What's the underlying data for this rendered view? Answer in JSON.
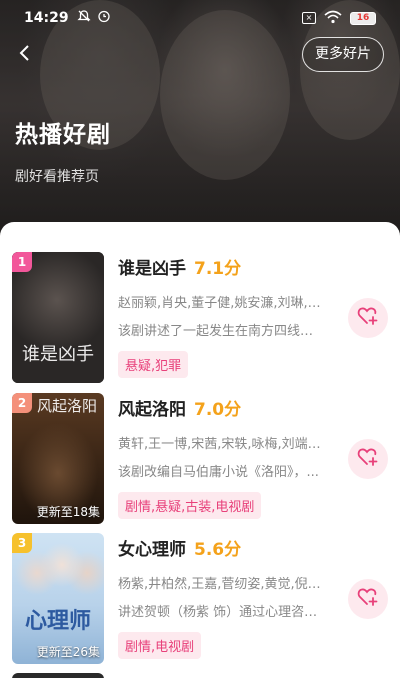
{
  "status_bar": {
    "time": "14:29",
    "icons": [
      "mute-icon",
      "alarm-icon"
    ],
    "right_icons": [
      "sim-icon",
      "wifi-icon",
      "battery-icon"
    ],
    "sim_label": "×",
    "battery_level": "16"
  },
  "header": {
    "back_icon": "chevron-left-icon",
    "more_button_label": "更多好片",
    "title": "热播好剧",
    "subtitle": "剧好看推荐页"
  },
  "colors": {
    "accent_pink": "#e8407a",
    "score_orange": "#f4a21b",
    "tag_background": "#fde9ee",
    "rank_1": "#f2579a",
    "rank_2": "#f4907a",
    "rank_3": "#f6c12d"
  },
  "shows": [
    {
      "rank": "1",
      "title": "谁是凶手",
      "score": "7.1分",
      "cast": "赵丽颖,肖央,董子健,姚安濂,刘琳,常...",
      "description": "该剧讲述了一起发生在南方四线小...",
      "tags": "悬疑,犯罪",
      "poster_caption": "",
      "poster_text": "谁是凶手",
      "fav_icon": "heart-plus-icon"
    },
    {
      "rank": "2",
      "title": "风起洛阳",
      "score": "7.0分",
      "cast": "黄轩,王一博,宋茜,宋轶,咏梅,刘端端...",
      "description": "该剧改编自马伯庸小说《洛阳》，...",
      "tags": "剧情,悬疑,古装,电视剧",
      "poster_caption": "更新至18集",
      "poster_text": "风起洛阳",
      "fav_icon": "heart-plus-icon"
    },
    {
      "rank": "3",
      "title": "女心理师",
      "score": "5.6分",
      "cast": "杨紫,井柏然,王嘉,菅纫姿,黄觉,倪萍...",
      "description": "讲述贺顿（杨紫 饰）通过心理咨询...",
      "tags": "剧情,电视剧",
      "poster_caption": "更新至26集",
      "poster_text": "心理师",
      "fav_icon": "heart-plus-icon"
    }
  ]
}
